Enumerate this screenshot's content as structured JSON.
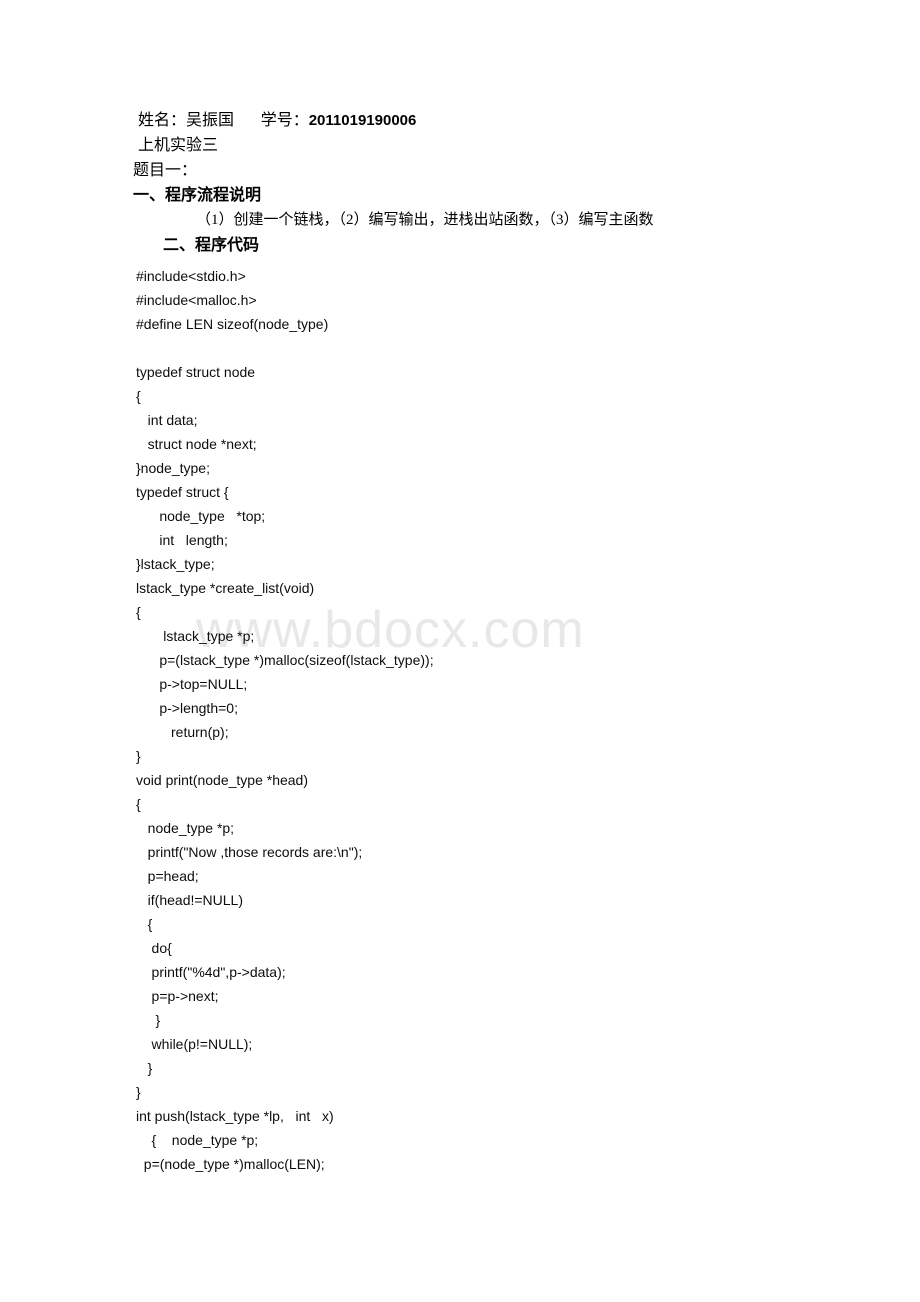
{
  "document": {
    "watermark": "www.bdocx.com",
    "header": {
      "name_label": "姓名：",
      "name_value": "吴振国",
      "student_id_label": "学号：",
      "student_id_value": "2011019190006",
      "experiment_title": "上机实验三",
      "topic_title": "题目一："
    },
    "sections": [
      {
        "heading": "一、程序流程说明",
        "body": "（1）创建一个链栈，（2）编写输出，进栈出站函数，（3）编写主函数"
      },
      {
        "heading": "二、程序代码",
        "body": ""
      }
    ],
    "code_lines": [
      "#include<stdio.h>",
      "#include<malloc.h>",
      "#define LEN sizeof(node_type)",
      "",
      "typedef struct node",
      "{",
      "   int data;",
      "   struct node *next;",
      "}node_type;",
      "typedef struct {",
      "      node_type   *top;",
      "      int   length;",
      "}lstack_type;",
      "lstack_type *create_list(void)",
      "{",
      "       lstack_type *p;",
      "      p=(lstack_type *)malloc(sizeof(lstack_type));",
      "      p->top=NULL;",
      "      p->length=0;",
      "         return(p);",
      "}",
      "void print(node_type *head)",
      "{",
      "   node_type *p;",
      "   printf(\"Now ,those records are:\\n\");",
      "   p=head;",
      "   if(head!=NULL)",
      "   {",
      "    do{",
      "    printf(\"%4d\",p->data);",
      "    p=p->next;",
      "     }",
      "    while(p!=NULL);",
      "   }",
      "}",
      "int push(lstack_type *lp,   int   x)",
      "    {    node_type *p;",
      "  p=(node_type *)malloc(LEN);"
    ]
  }
}
